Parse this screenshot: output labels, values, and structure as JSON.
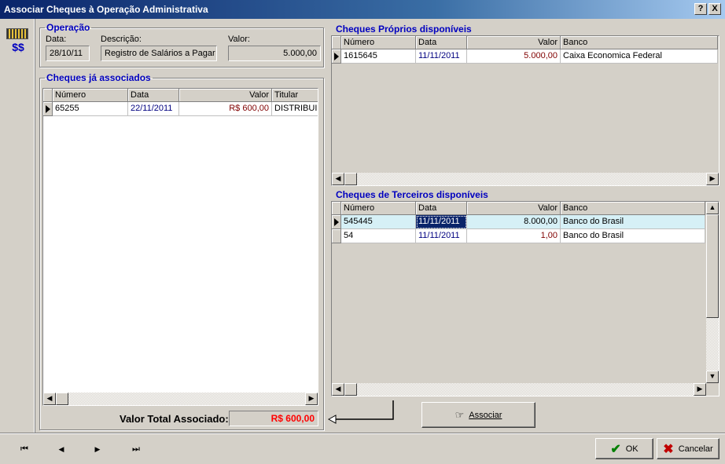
{
  "window": {
    "title": "Associar Cheques à Operação Administrativa",
    "help_label": "?",
    "close_label": "X"
  },
  "operacao": {
    "legend": "Operação",
    "data_label": "Data:",
    "data_value": "28/10/11",
    "descricao_label": "Descrição:",
    "descricao_value": "Registro de Salários a Pagar",
    "valor_label": "Valor:",
    "valor_value": "5.000,00"
  },
  "associados": {
    "legend": "Cheques já associados",
    "columns": [
      "Número",
      "Data",
      "Valor",
      "Titular"
    ],
    "rows": [
      {
        "numero": "65255",
        "data": "22/11/2011",
        "valor": "R$ 600,00",
        "titular": "DISTRIBUID"
      }
    ],
    "total_label": "Valor Total Associado:",
    "total_value": "R$ 600,00"
  },
  "proprios": {
    "title": "Cheques Próprios disponíveis",
    "columns": [
      "Número",
      "Data",
      "Valor",
      "Banco"
    ],
    "rows": [
      {
        "numero": "1615645",
        "data": "11/11/2011",
        "valor": "5.000,00",
        "banco": "Caixa Economica Federal"
      }
    ]
  },
  "terceiros": {
    "title": "Cheques de Terceiros disponíveis",
    "columns": [
      "Número",
      "Data",
      "Valor",
      "Banco"
    ],
    "rows": [
      {
        "numero": "545445",
        "data": "11/11/2011",
        "valor": "8.000,00",
        "banco": "Banco do Brasil"
      },
      {
        "numero": "54",
        "data": "11/11/2011",
        "valor": "1,00",
        "banco": "Banco do Brasil"
      }
    ]
  },
  "buttons": {
    "associar": "Associar",
    "ok": "OK",
    "cancelar": "Cancelar"
  },
  "icons": {
    "money": "money-icon",
    "nav_first": "⏮",
    "nav_prev": "◀",
    "nav_next": "▶",
    "nav_last": "⏭"
  },
  "colors": {
    "title_gradient_start": "#0a246a",
    "accent_blue": "#0000c0",
    "total_red": "#ff0000",
    "selected_row": "#d6f0f6"
  }
}
